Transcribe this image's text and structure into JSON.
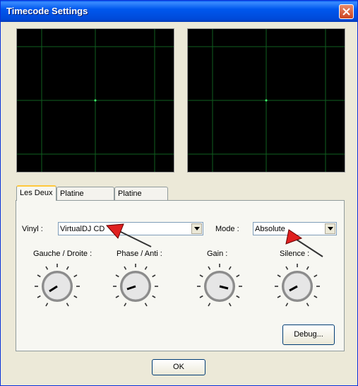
{
  "window": {
    "title": "Timecode Settings"
  },
  "tabs": [
    {
      "label": "Les Deux",
      "active": true
    },
    {
      "label": "Platine Gauche",
      "active": false
    },
    {
      "label": "Platine Droite",
      "active": false
    }
  ],
  "vinyl": {
    "label": "Vinyl :",
    "value": "VirtualDJ CD"
  },
  "mode": {
    "label": "Mode :",
    "value": "Absolute"
  },
  "knobs": [
    {
      "label": "Gauche / Droite :"
    },
    {
      "label": "Phase / Anti :"
    },
    {
      "label": "Gain :"
    },
    {
      "label": "Silence :"
    }
  ],
  "buttons": {
    "debug": "Debug...",
    "ok": "OK"
  },
  "colors": {
    "scope_grid": "#0f5f1f",
    "accent_arrow": "#e02020",
    "scope_bg": "#000000"
  }
}
